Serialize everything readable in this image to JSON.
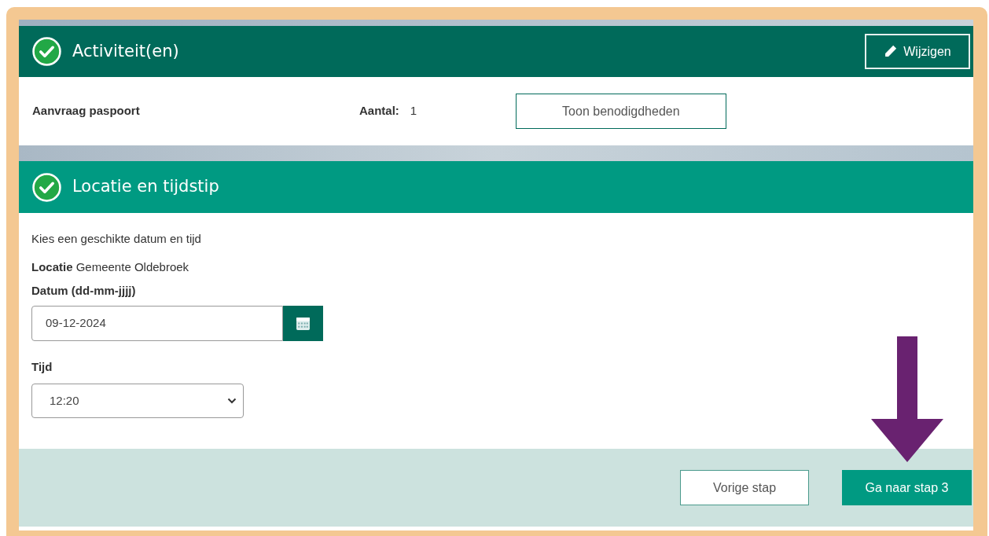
{
  "activities": {
    "title": "Activiteit(en)",
    "completed": true,
    "edit_button": "Wijzigen",
    "item": {
      "name": "Aanvraag paspoort",
      "count_label": "Aantal:",
      "count": "1",
      "button": "Toon benodigdheden"
    }
  },
  "location_time": {
    "title": "Locatie en tijdstip",
    "completed": true,
    "intro": "Kies een geschikte datum en tijd",
    "location_label": "Locatie",
    "location_value": "Gemeente Oldebroek",
    "date_label": "Datum (dd-mm-jjjj)",
    "date_value": "09-12-2024",
    "time_label": "Tijd",
    "time_value": "12:20"
  },
  "footer": {
    "buttons": [
      "Vorige stap",
      "Ga naar stap 3"
    ]
  }
}
